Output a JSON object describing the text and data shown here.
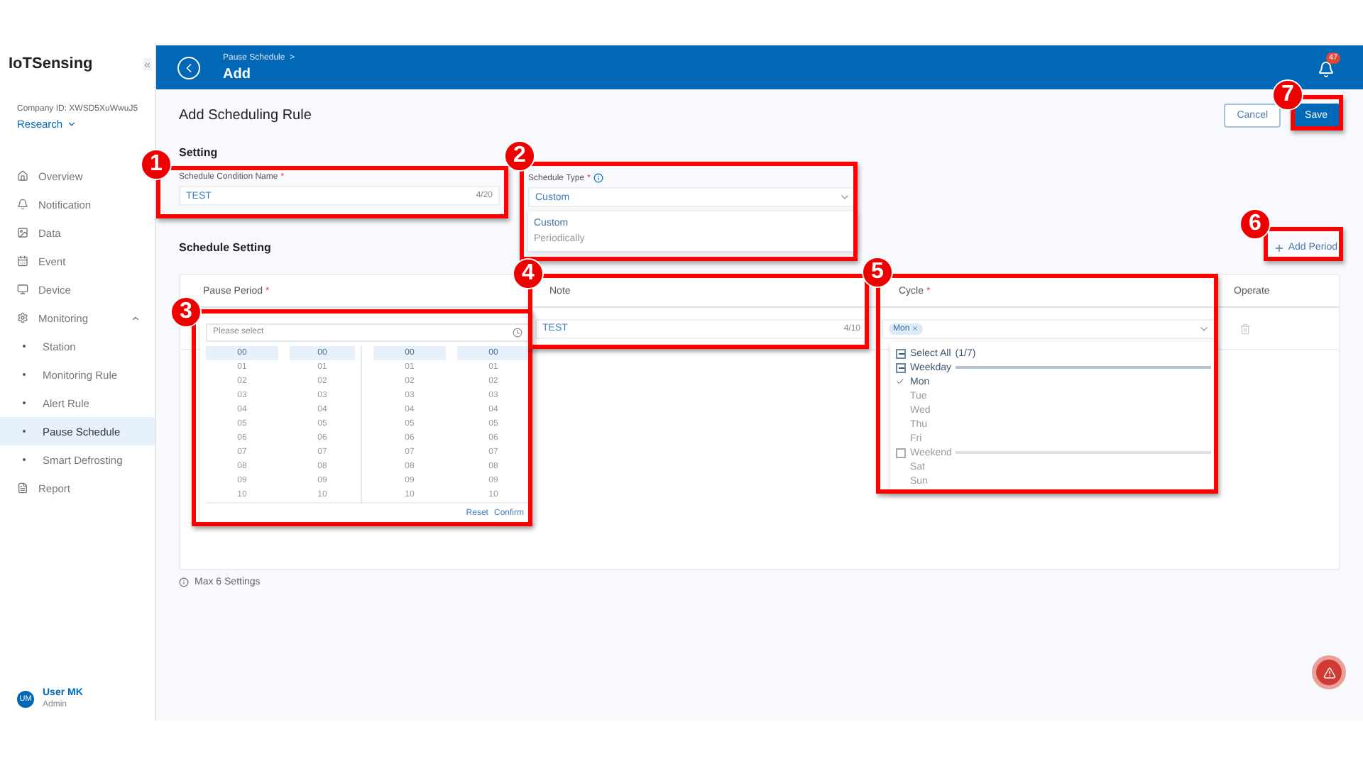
{
  "sidebar": {
    "brand": "IoTSensing",
    "collapse": "«",
    "company_id": "Company ID: XWSD5XuWwuJ5",
    "workspace": "Research",
    "items": [
      {
        "label": "Overview",
        "selected": false
      },
      {
        "label": "Notification",
        "selected": false
      },
      {
        "label": "Data",
        "selected": false
      },
      {
        "label": "Event",
        "selected": false
      },
      {
        "label": "Device",
        "selected": false
      },
      {
        "label": "Monitoring",
        "selected": false,
        "expanded": true,
        "children": [
          {
            "label": "Station",
            "selected": false
          },
          {
            "label": "Monitoring Rule",
            "selected": false
          },
          {
            "label": "Alert Rule",
            "selected": false
          },
          {
            "label": "Pause Schedule",
            "selected": true
          },
          {
            "label": "Smart Defrosting",
            "selected": false
          }
        ]
      },
      {
        "label": "Report",
        "selected": false
      }
    ],
    "user": {
      "initials": "UM",
      "name": "User MK",
      "role": "Admin"
    }
  },
  "header": {
    "breadcrumb": "Pause Schedule",
    "breadcrumb_separator": ">",
    "title": "Add",
    "notification_count": "47"
  },
  "page": {
    "title": "Add Scheduling Rule",
    "buttons": [
      {
        "label": "Cancel",
        "kind": "secondary"
      },
      {
        "label": "Save",
        "kind": "primary"
      }
    ]
  },
  "setting": {
    "heading": "Setting",
    "name_field": {
      "label": "Schedule Condition Name",
      "required": "*",
      "value": "TEST",
      "counter": "4/20"
    },
    "type_field": {
      "label": "Schedule Type",
      "required": "*",
      "value": "Custom",
      "options": [
        {
          "label": "Custom",
          "selected": true
        },
        {
          "label": "Periodically",
          "selected": false
        }
      ]
    }
  },
  "schedule_setting": {
    "heading": "Schedule Setting",
    "add_button": "Add Period",
    "columns": [
      {
        "label": "Pause Period",
        "required": "*"
      },
      {
        "label": "Note"
      },
      {
        "label": "Cycle",
        "required": "*"
      },
      {
        "label": "Operate"
      }
    ],
    "row": {
      "note": {
        "value": "TEST",
        "counter": "4/10"
      },
      "cycle_tags": [
        "Mon"
      ]
    },
    "time_picker": {
      "placeholder": "Please select",
      "reset": "Reset",
      "confirm": "Confirm",
      "columns": [
        {
          "options": [
            {
              "label": "00",
              "selected": true
            },
            {
              "label": "01",
              "selected": false
            },
            {
              "label": "02",
              "selected": false
            },
            {
              "label": "03",
              "selected": false
            },
            {
              "label": "04",
              "selected": false
            },
            {
              "label": "05",
              "selected": false
            },
            {
              "label": "06",
              "selected": false
            },
            {
              "label": "07",
              "selected": false
            },
            {
              "label": "08",
              "selected": false
            },
            {
              "label": "09",
              "selected": false
            },
            {
              "label": "10",
              "selected": false
            }
          ]
        },
        {
          "options": [
            {
              "label": "00",
              "selected": true
            },
            {
              "label": "01",
              "selected": false
            },
            {
              "label": "02",
              "selected": false
            },
            {
              "label": "03",
              "selected": false
            },
            {
              "label": "04",
              "selected": false
            },
            {
              "label": "05",
              "selected": false
            },
            {
              "label": "06",
              "selected": false
            },
            {
              "label": "07",
              "selected": false
            },
            {
              "label": "08",
              "selected": false
            },
            {
              "label": "09",
              "selected": false
            },
            {
              "label": "10",
              "selected": false
            }
          ]
        },
        {
          "options": [
            {
              "label": "00",
              "selected": true
            },
            {
              "label": "01",
              "selected": false
            },
            {
              "label": "02",
              "selected": false
            },
            {
              "label": "03",
              "selected": false
            },
            {
              "label": "04",
              "selected": false
            },
            {
              "label": "05",
              "selected": false
            },
            {
              "label": "06",
              "selected": false
            },
            {
              "label": "07",
              "selected": false
            },
            {
              "label": "08",
              "selected": false
            },
            {
              "label": "09",
              "selected": false
            },
            {
              "label": "10",
              "selected": false
            }
          ]
        },
        {
          "options": [
            {
              "label": "00",
              "selected": true
            },
            {
              "label": "01",
              "selected": false
            },
            {
              "label": "02",
              "selected": false
            },
            {
              "label": "03",
              "selected": false
            },
            {
              "label": "04",
              "selected": false
            },
            {
              "label": "05",
              "selected": false
            },
            {
              "label": "06",
              "selected": false
            },
            {
              "label": "07",
              "selected": false
            },
            {
              "label": "08",
              "selected": false
            },
            {
              "label": "09",
              "selected": false
            },
            {
              "label": "10",
              "selected": false
            }
          ]
        }
      ]
    },
    "cycle_menu": {
      "select_all": {
        "label": "Select All",
        "count": "(1/7)",
        "indeterminate": true
      },
      "groups": [
        {
          "label": "Weekday",
          "indeterminate": true,
          "days": [
            {
              "label": "Mon",
              "checked": true
            },
            {
              "label": "Tue",
              "checked": false
            },
            {
              "label": "Wed",
              "checked": false
            },
            {
              "label": "Thu",
              "checked": false
            },
            {
              "label": "Fri",
              "checked": false
            }
          ]
        },
        {
          "label": "Weekend",
          "indeterminate": false,
          "days": [
            {
              "label": "Sat",
              "checked": false
            },
            {
              "label": "Sun",
              "checked": false
            }
          ]
        }
      ]
    },
    "hint": "Max 6 Settings"
  },
  "annotations": [
    {
      "number": "1"
    },
    {
      "number": "2"
    },
    {
      "number": "3"
    },
    {
      "number": "4"
    },
    {
      "number": "5"
    },
    {
      "number": "6"
    },
    {
      "number": "7"
    }
  ]
}
